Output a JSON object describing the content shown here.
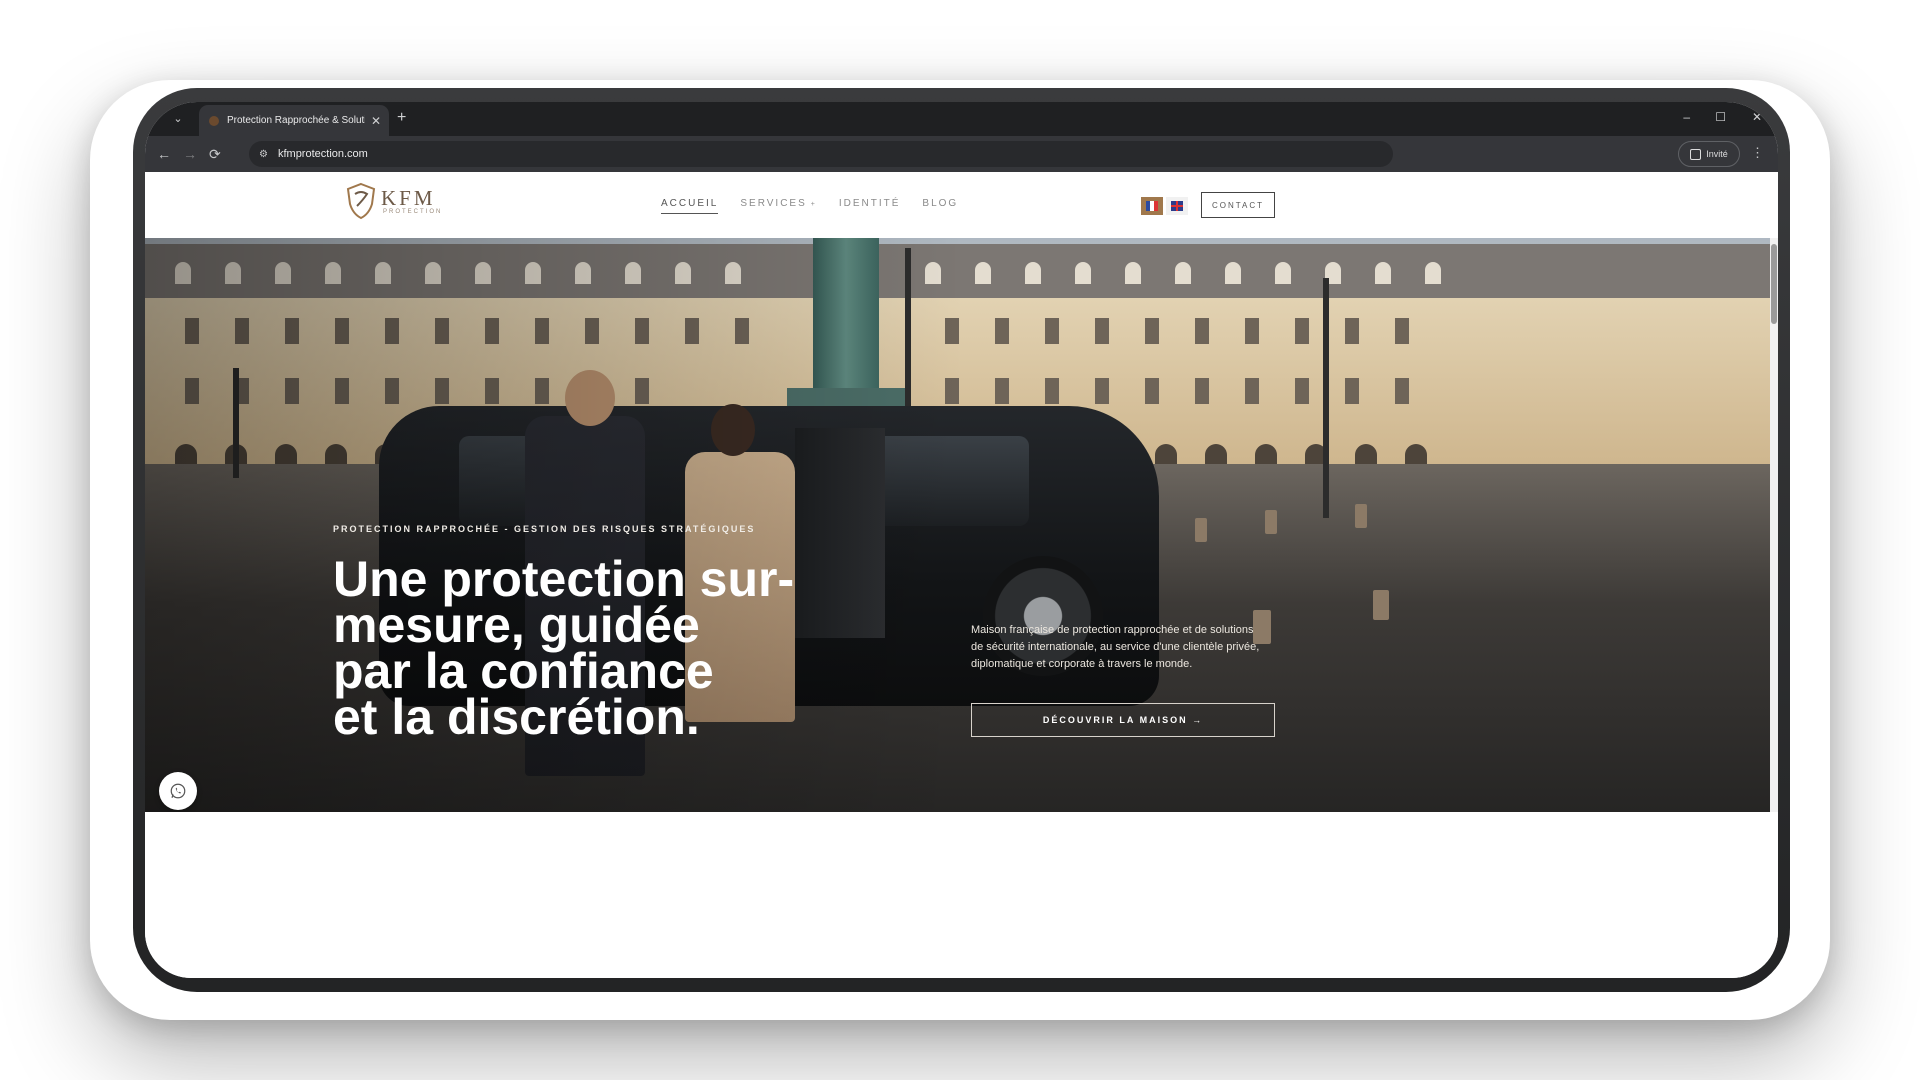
{
  "browser": {
    "tab_title": "Protection Rapprochée & Soluti",
    "tab_close": "✕",
    "new_tab": "+",
    "tab_dropdown": "⌄",
    "back": "←",
    "forward": "→",
    "reload": "⟳",
    "url": "kfmprotection.com",
    "profile_label": "Invité",
    "menu": "⋮",
    "minimize": "–",
    "maximize": "☐",
    "close": "✕"
  },
  "site": {
    "logo_text": "KFM",
    "logo_sub": "PROTECTION",
    "nav": [
      {
        "label": "ACCUEIL"
      },
      {
        "label": "SERVICES"
      },
      {
        "label": "IDENTITÉ"
      },
      {
        "label": "BLOG"
      }
    ],
    "services_caret": "+",
    "contact_label": "CONTACT"
  },
  "hero": {
    "eyebrow": "PROTECTION RAPPROCHÉE - GESTION DES RISQUES STRATÉGIQUES",
    "headline_lines": [
      "Une protection sur-",
      "mesure, guidée",
      "par la confiance",
      "et la discrétion."
    ],
    "description": "Maison française de protection rapprochée et de solutions de sécurité internationale, au service d'une clientèle privée, diplomatique et corporate à travers le monde.",
    "cta_label": "DÉCOUVRIR LA MAISON  →"
  },
  "colors": {
    "accent_gold": "#a0784c",
    "logo_brown": "#6d5a48",
    "chrome_dark": "#35363a"
  },
  "icons": {
    "whatsapp": "whatsapp-icon",
    "logo": "shield-logo-icon"
  }
}
